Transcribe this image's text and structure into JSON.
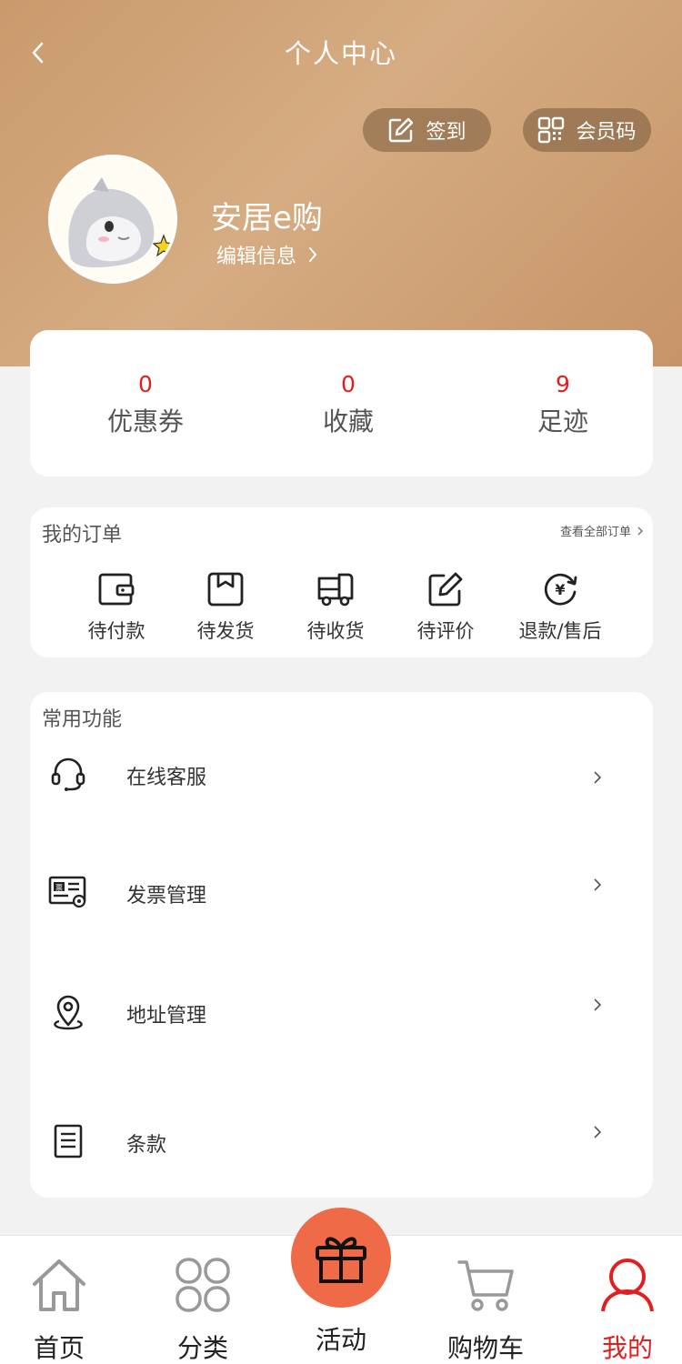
{
  "header": {
    "title": "个人中心",
    "signin_label": "签到",
    "member_code_label": "会员码"
  },
  "profile": {
    "name": "安居e购",
    "edit_label": "编辑信息"
  },
  "stats": [
    {
      "value": "0",
      "label": "优惠券"
    },
    {
      "value": "0",
      "label": "收藏"
    },
    {
      "value": "9",
      "label": "足迹"
    }
  ],
  "orders": {
    "title": "我的订单",
    "view_all": "查看全部订单",
    "items": [
      {
        "label": "待付款",
        "icon": "wallet-icon"
      },
      {
        "label": "待发货",
        "icon": "package-icon"
      },
      {
        "label": "待收货",
        "icon": "truck-icon"
      },
      {
        "label": "待评价",
        "icon": "edit-icon"
      },
      {
        "label": "退款/售后",
        "icon": "refund-icon"
      }
    ]
  },
  "functions": {
    "title": "常用功能",
    "items": [
      {
        "label": "在线客服",
        "icon": "headset-icon"
      },
      {
        "label": "发票管理",
        "icon": "invoice-icon"
      },
      {
        "label": "地址管理",
        "icon": "location-icon"
      },
      {
        "label": "条款",
        "icon": "document-icon"
      }
    ]
  },
  "tabbar": {
    "items": [
      {
        "label": "首页",
        "icon": "home-icon"
      },
      {
        "label": "分类",
        "icon": "category-icon"
      },
      {
        "label": "活动",
        "icon": "gift-icon"
      },
      {
        "label": "购物车",
        "icon": "cart-icon"
      },
      {
        "label": "我的",
        "icon": "user-icon"
      }
    ],
    "active_color": "#e02020",
    "accent_color": "#ef6a46"
  }
}
